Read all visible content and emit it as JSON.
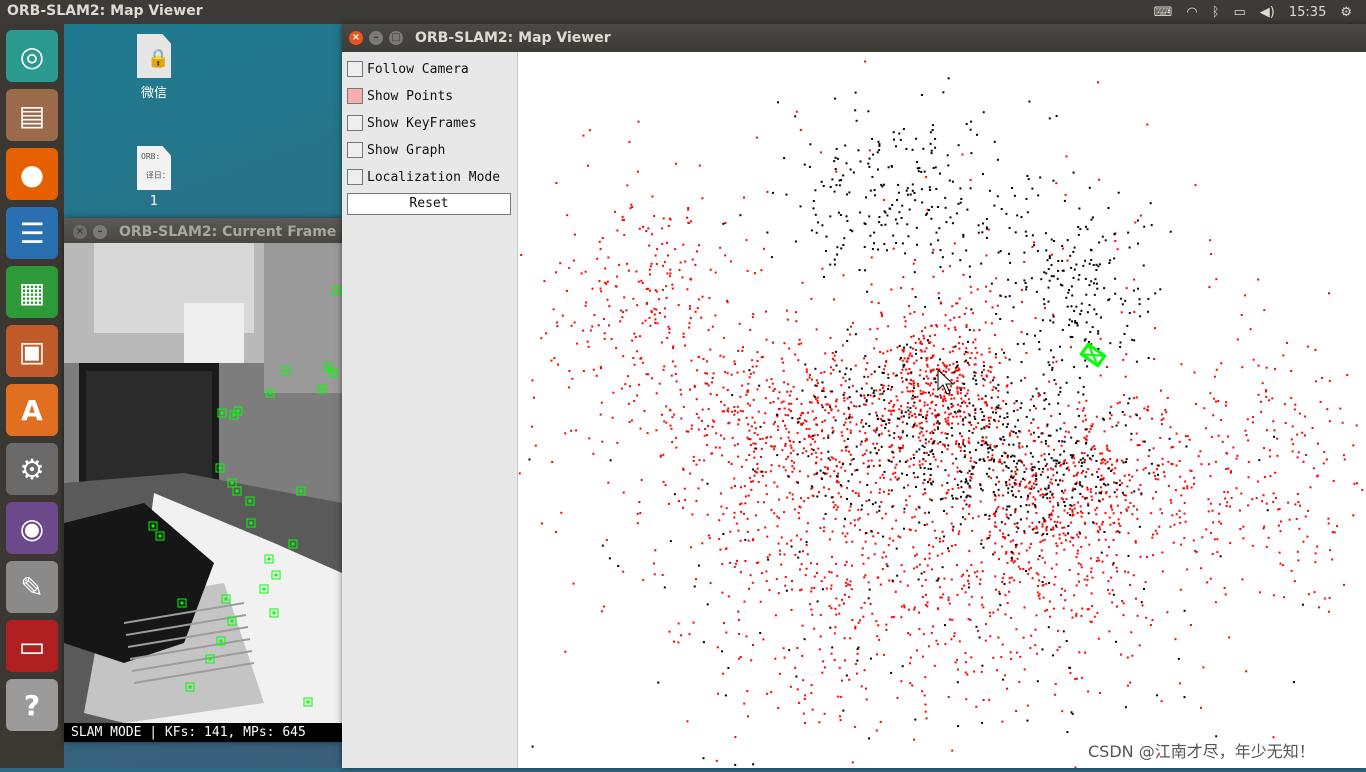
{
  "topbar": {
    "title": "ORB-SLAM2: Map Viewer",
    "time": "15:35",
    "tray_icons": [
      "keyboard-icon",
      "wifi-icon",
      "bluetooth-icon",
      "battery-icon",
      "volume-icon"
    ]
  },
  "launcher": {
    "items": [
      {
        "name": "ubuntu-dash-icon",
        "color": "#2a9a8e",
        "glyph": "◎"
      },
      {
        "name": "files-icon",
        "color": "#9a6a4a",
        "glyph": "▤"
      },
      {
        "name": "firefox-icon",
        "color": "#e66000",
        "glyph": "●"
      },
      {
        "name": "writer-icon",
        "color": "#2a6fb0",
        "glyph": "☰"
      },
      {
        "name": "calc-icon",
        "color": "#2e9a3a",
        "glyph": "▦"
      },
      {
        "name": "impress-icon",
        "color": "#c05a28",
        "glyph": "▣"
      },
      {
        "name": "software-center-icon",
        "color": "#e07020",
        "glyph": "A"
      },
      {
        "name": "system-settings-icon",
        "color": "#6a6a6a",
        "glyph": "⚙"
      },
      {
        "name": "video-icon",
        "color": "#6a4a8a",
        "glyph": "◉"
      },
      {
        "name": "text-editor-icon",
        "color": "#8a8a8a",
        "glyph": "✎"
      },
      {
        "name": "terminal-icon",
        "color": "#b02020",
        "glyph": "▭"
      },
      {
        "name": "help-icon",
        "color": "#9a9a9a",
        "glyph": "?"
      }
    ]
  },
  "desktop": {
    "icons": [
      {
        "label": "微信",
        "file_text": ""
      },
      {
        "label": "1",
        "file_text": "ORB:\n\n 译日："
      }
    ]
  },
  "frame_window": {
    "title": "ORB-SLAM2: Current Frame",
    "status": "SLAM MODE |  KFs: 141, MPs: 645"
  },
  "map_window": {
    "title": "ORB-SLAM2: Map Viewer",
    "controls": [
      {
        "label": "Follow Camera",
        "checked": false
      },
      {
        "label": "Show Points",
        "checked": true
      },
      {
        "label": "Show KeyFrames",
        "checked": false
      },
      {
        "label": "Show Graph",
        "checked": false
      },
      {
        "label": "Localization Mode",
        "checked": false
      }
    ],
    "reset_label": "Reset"
  },
  "colors": {
    "map_points_reference": "#ff0000",
    "map_points_all": "#000000",
    "camera": "#00ff00",
    "feature_marker": "#00ff00"
  },
  "watermark": "CSDN @江南才尽，年少无知！"
}
